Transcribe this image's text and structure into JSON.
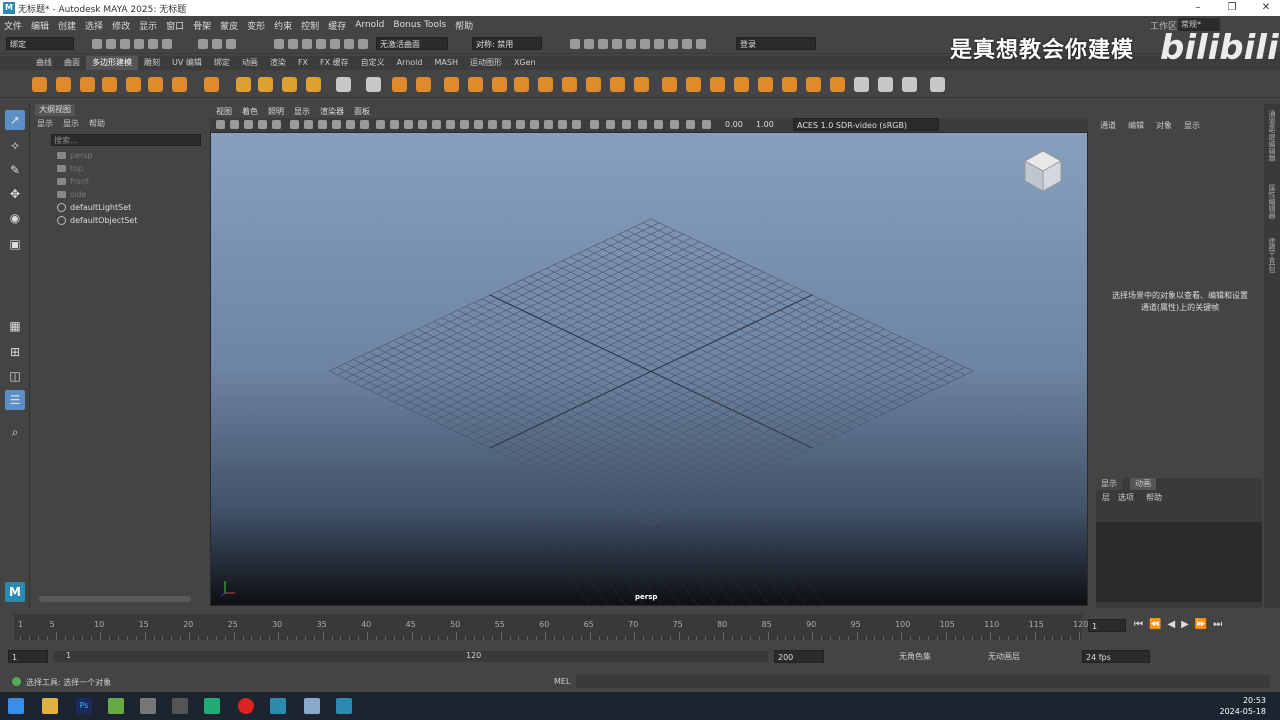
{
  "window": {
    "title": "无标题* - Autodesk MAYA 2025: 无标题"
  },
  "menu": [
    "文件",
    "编辑",
    "创建",
    "选择",
    "修改",
    "显示",
    "窗口",
    "骨架",
    "蒙皮",
    "变形",
    "约束",
    "控制",
    "缓存",
    "Arnold",
    "Bonus Tools",
    "帮助"
  ],
  "workspace": {
    "label": "工作区:",
    "value": "常规*"
  },
  "toolbar": {
    "mode": "绑定",
    "live_surface": "无激活曲面",
    "symmetry": "对称: 禁用",
    "login": "登录"
  },
  "shelf_tabs": [
    "曲线",
    "曲面",
    "多边形建模",
    "雕刻",
    "UV 编辑",
    "绑定",
    "动画",
    "渲染",
    "FX",
    "FX 缓存",
    "自定义",
    "Arnold",
    "MASH",
    "运动图形",
    "XGen"
  ],
  "shelf_active": "多边形建模",
  "watermark": "是真想教会你建模",
  "bili": "bilibili",
  "outliner": {
    "tab": "大纲视图",
    "menu": [
      "显示",
      "显示",
      "帮助"
    ],
    "search": "搜索...",
    "items": [
      "persp",
      "top",
      "front",
      "side",
      "defaultLightSet",
      "defaultObjectSet"
    ]
  },
  "viewport": {
    "menu": [
      "视图",
      "着色",
      "照明",
      "显示",
      "渲染器",
      "面板"
    ],
    "camera": "persp",
    "near": "0.00",
    "far": "1.00",
    "colorspace": "ACES 1.0 SDR-video (sRGB)"
  },
  "channelbox": {
    "menu": [
      "通道",
      "编辑",
      "对象",
      "显示"
    ],
    "message": "选择场景中的对象以查看、编辑和设置通道(属性)上的关键帧",
    "lower_tabs": [
      "显示",
      "动画"
    ],
    "lower_menu": [
      "层",
      "选项",
      "帮助"
    ]
  },
  "sidetabs": [
    "通道盒/层编辑器",
    "属性编辑器",
    "建模工具包"
  ],
  "timeline": {
    "ticks": [
      "5",
      "10",
      "15",
      "20",
      "25",
      "30",
      "35",
      "40",
      "45",
      "50",
      "55",
      "60",
      "65",
      "70",
      "75",
      "80",
      "85",
      "90",
      "95",
      "100",
      "105",
      "110",
      "115",
      "120"
    ],
    "start_tick": "1",
    "current": "1"
  },
  "range": {
    "start": "1",
    "inner_start": "1",
    "inner_end": "120",
    "end": "200",
    "character": "无角色集",
    "anim_layer": "无动画层",
    "fps": "24 fps"
  },
  "status": {
    "help": "选择工具: 选择一个对象",
    "mel": "MEL"
  },
  "clock": {
    "time": "20:53",
    "date": "2024-05-18"
  }
}
